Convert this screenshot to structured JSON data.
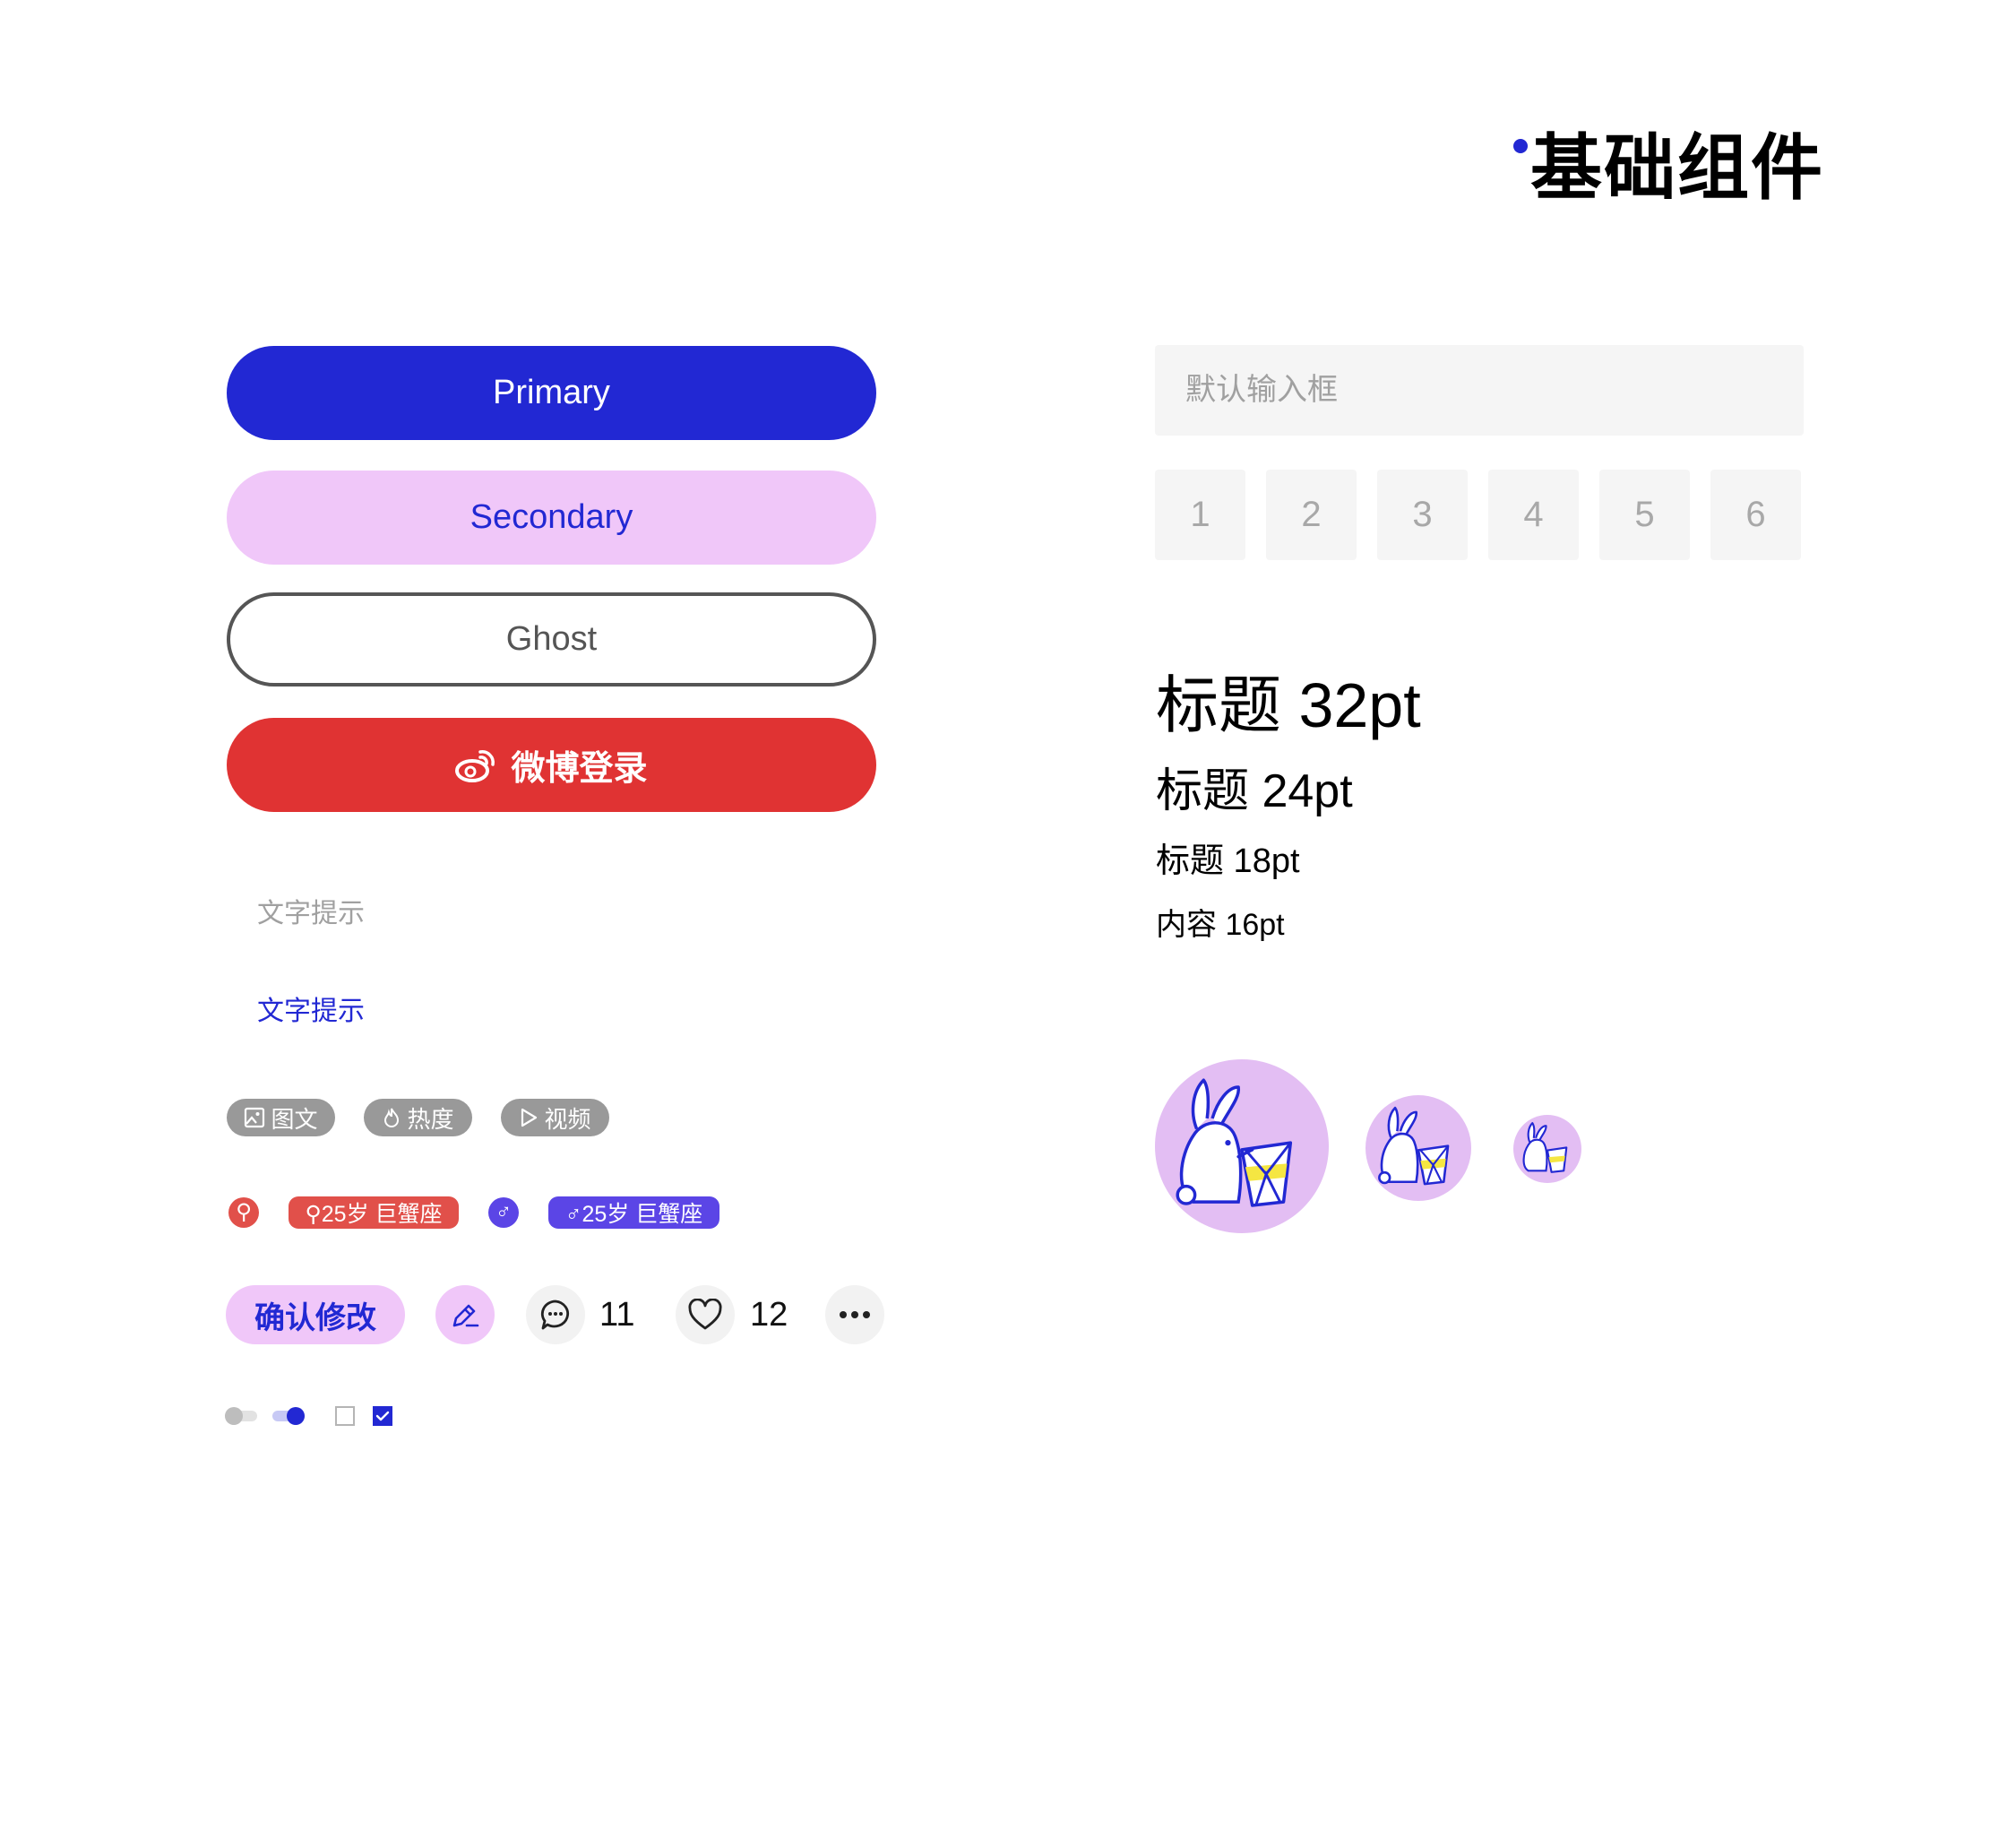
{
  "header": {
    "title": "基础组件"
  },
  "buttons": {
    "primary": "Primary",
    "secondary": "Secondary",
    "ghost": "Ghost",
    "weibo_login": "微博登录"
  },
  "hints": {
    "gray": "文字提示",
    "blue": "文字提示"
  },
  "tags": [
    {
      "label": "图文",
      "icon": "image-icon"
    },
    {
      "label": "热度",
      "icon": "flame-icon"
    },
    {
      "label": "视频",
      "icon": "play-icon"
    }
  ],
  "gender_badges": {
    "female_symbol": "⚲",
    "female_label": "⚲25岁 巨蟹座",
    "male_symbol": "♂",
    "male_label": "♂25岁 巨蟹座"
  },
  "actions": {
    "confirm_label": "确认修改",
    "comment_count": "11",
    "like_count": "12"
  },
  "controls": {
    "toggle_off": false,
    "toggle_on": true,
    "checkbox_unchecked": false,
    "checkbox_checked": true
  },
  "form": {
    "input_placeholder": "默认输入框",
    "code_digits": [
      "1",
      "2",
      "3",
      "4",
      "5",
      "6"
    ]
  },
  "typography": {
    "h32": "标题 32pt",
    "h24": "标题 24pt",
    "h18": "标题 18pt",
    "body16": "内容 16pt"
  },
  "colors": {
    "primary": "#2228D3",
    "secondary_bg": "#F0C7F9",
    "weibo_red": "#E03333",
    "female": "#E1504A",
    "male": "#5B45E6",
    "avatar_bg": "#E3BEF3",
    "tag_gray": "#999999"
  }
}
